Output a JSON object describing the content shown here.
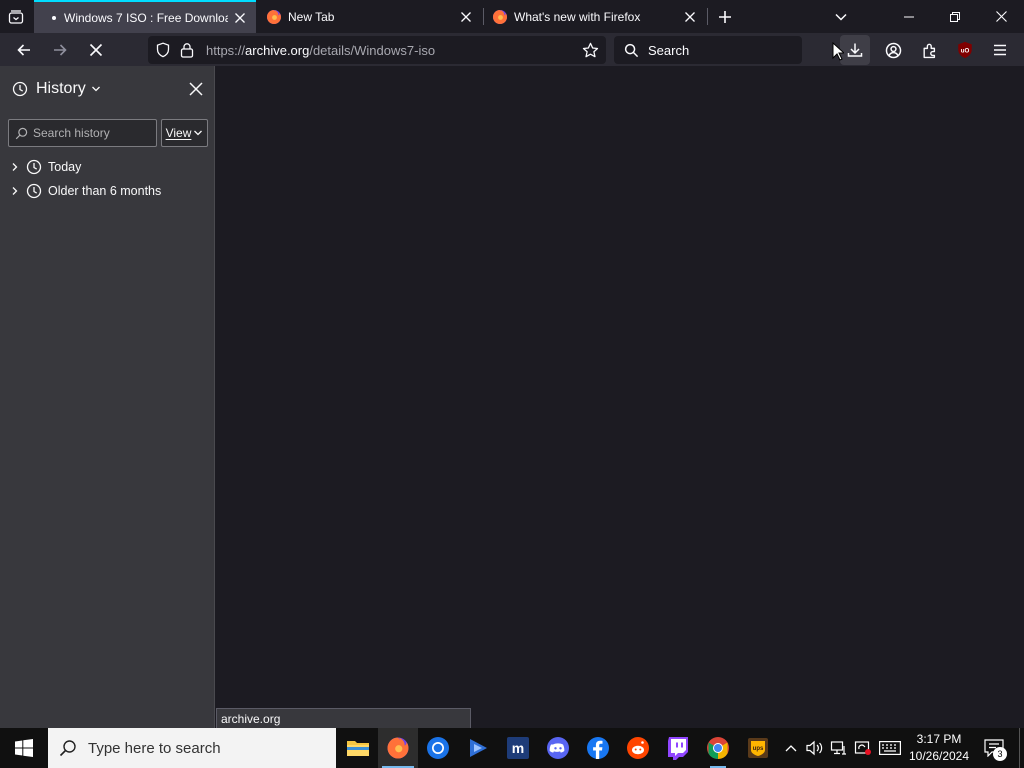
{
  "tabs": [
    {
      "title": "Windows 7 ISO : Free Download",
      "selected": true
    },
    {
      "title": "New Tab",
      "selected": false
    },
    {
      "title": "What's new with Firefox",
      "selected": false
    }
  ],
  "navbar": {
    "url_host_prefix": "https://",
    "url_host": "archive.org",
    "url_path": "/details/Windows7-iso",
    "search_placeholder": "Search"
  },
  "sidebar": {
    "title": "History",
    "search_placeholder": "Search history",
    "view_label": "View",
    "groups": [
      {
        "label": "Today"
      },
      {
        "label": "Older than 6 months"
      }
    ]
  },
  "status": {
    "text": "archive.org"
  },
  "taskbar": {
    "search_placeholder": "Type here to search",
    "time": "3:17 PM",
    "date": "10/26/2024",
    "notification_count": "3"
  },
  "colors": {
    "accent": "#00ddff",
    "tab_selected_bg": "#42414d",
    "toolbar_bg": "#2b2a33",
    "sidebar_bg": "#38383d",
    "content_bg": "#1c1b22",
    "taskbar_bg": "#101010"
  },
  "icons": {
    "tab_list": "tab-list-icon",
    "new_tab": "plus-icon",
    "back": "back-arrow-icon",
    "forward": "forward-arrow-icon",
    "stop": "stop-icon",
    "shield": "tracking-shield-icon",
    "lock": "lock-icon",
    "bookmark": "star-icon",
    "download": "download-icon",
    "account": "account-icon",
    "extensions": "extensions-icon",
    "ublock": "ublock-origin-icon",
    "menu": "hamburger-menu-icon"
  }
}
